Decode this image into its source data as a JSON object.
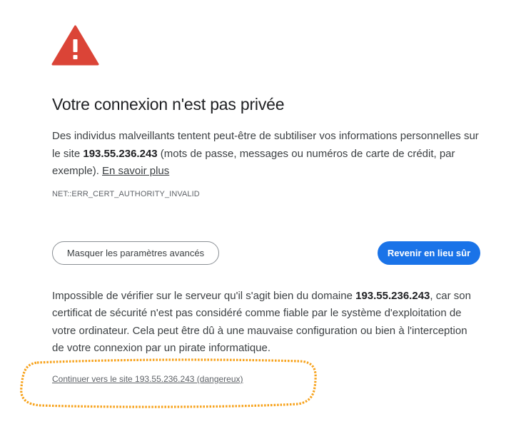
{
  "title": "Votre connexion n'est pas privée",
  "intro": {
    "part1": "Des individus malveillants tentent peut-être de subtiliser vos informations personnelles sur le site ",
    "host": "193.55.236.243",
    "part2": " (mots de passe, messages ou numéros de carte de crédit, par exemple). ",
    "learn_more": "En savoir plus"
  },
  "error_code": "NET::ERR_CERT_AUTHORITY_INVALID",
  "buttons": {
    "advanced": "Masquer les paramètres avancés",
    "back": "Revenir en lieu sûr"
  },
  "details": {
    "part1": "Impossible de vérifier sur le serveur qu'il s'agit bien du domaine ",
    "host": "193.55.236.243",
    "part2": ", car son certificat de sécurité n'est pas considéré comme fiable par le système d'exploitation de votre ordinateur. Cela peut être dû à une mauvaise configuration ou bien à l'interception de votre connexion par un pirate informatique."
  },
  "proceed_link": "Continuer vers le site 193.55.236.243 (dangereux)",
  "colors": {
    "warning_red": "#db4437",
    "primary_blue": "#1a73e8",
    "highlight_orange": "#f7a21b"
  },
  "icons": {
    "warning": "warning-triangle-icon"
  }
}
